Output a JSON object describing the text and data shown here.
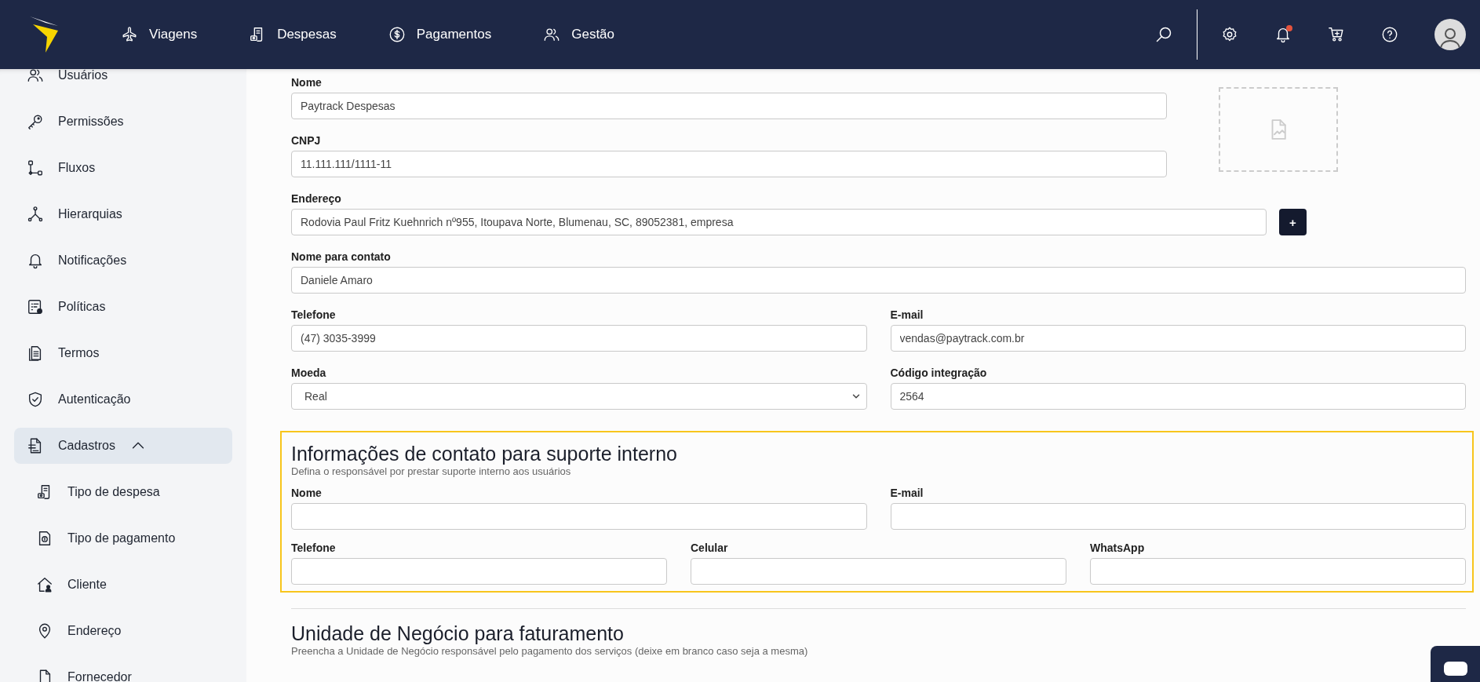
{
  "header": {
    "nav": [
      {
        "label": "Viagens"
      },
      {
        "label": "Despesas"
      },
      {
        "label": "Pagamentos"
      },
      {
        "label": "Gestão"
      }
    ],
    "notifications": {
      "unread": true
    }
  },
  "sidebar": {
    "items": [
      {
        "label": "Usuários",
        "selected": false
      },
      {
        "label": "Permissões",
        "selected": false
      },
      {
        "label": "Fluxos",
        "selected": false
      },
      {
        "label": "Hierarquias",
        "selected": false
      },
      {
        "label": "Notificações",
        "selected": false
      },
      {
        "label": "Políticas",
        "selected": false
      },
      {
        "label": "Termos",
        "selected": false
      },
      {
        "label": "Autenticação",
        "selected": false
      },
      {
        "label": "Cadastros",
        "selected": true,
        "expanded": true,
        "children": [
          {
            "label": "Tipo de despesa",
            "selected": false
          },
          {
            "label": "Tipo de pagamento",
            "selected": false
          },
          {
            "label": "Cliente",
            "selected": false
          },
          {
            "label": "Endereço",
            "selected": false
          },
          {
            "label": "Fornecedor",
            "selected": false
          }
        ]
      }
    ]
  },
  "company": {
    "name": {
      "label": "Nome",
      "value": "Paytrack Despesas"
    },
    "cnpj": {
      "label": "CNPJ",
      "value": "11.111.111/1111-11"
    },
    "address": {
      "label": "Endereço",
      "value": "Rodovia Paul Fritz Kuehnrich nº955, Itoupava Norte, Blumenau, SC, 89052381, empresa",
      "add_button": "+"
    },
    "contact_name": {
      "label": "Nome para contato",
      "value": "Daniele Amaro"
    },
    "phone": {
      "label": "Telefone",
      "value": "(47) 3035-3999"
    },
    "email": {
      "label": "E-mail",
      "value": "vendas@paytrack.com.br"
    },
    "currency": {
      "label": "Moeda",
      "value": "Real"
    },
    "integration_code": {
      "label": "Código integração",
      "value": "2564"
    }
  },
  "support_section": {
    "title": "Informações de contato para suporte interno",
    "subtitle": "Defina o responsável por prestar suporte interno aos usuários",
    "fields": [
      {
        "label": "Nome"
      },
      {
        "label": "E-mail"
      },
      {
        "label": "Telefone"
      },
      {
        "label": "Celular"
      },
      {
        "label": "WhatsApp"
      }
    ]
  },
  "billing_section": {
    "title": "Unidade de Negócio para faturamento",
    "subtitle": "Preencha a Unidade de Negócio responsável pelo pagamento dos serviços (deixe em branco caso seja a mesma)"
  }
}
